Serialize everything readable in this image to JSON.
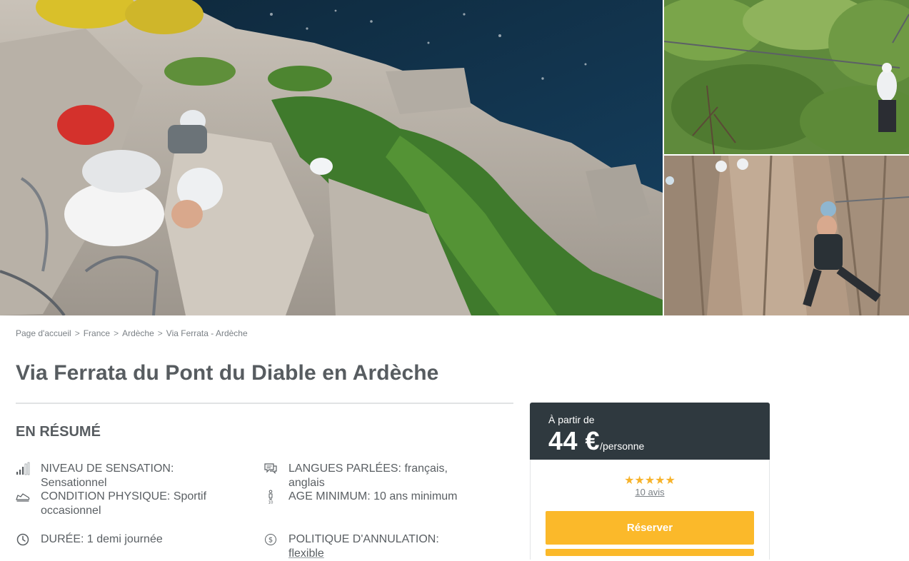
{
  "gallery": {
    "images": [
      {
        "name": "via-ferrata-climbers-above-river"
      },
      {
        "name": "zipline-over-forest"
      },
      {
        "name": "climber-on-rock-wall"
      }
    ]
  },
  "breadcrumb": {
    "items": [
      "Page d'accueil",
      "France",
      "Ardèche",
      "Via Ferrata - Ardèche"
    ],
    "separator": ">"
  },
  "page": {
    "title": "Via Ferrata du Pont du Diable en Ardèche"
  },
  "summary": {
    "heading": "EN RÉSUMÉ",
    "facts": [
      {
        "icon": "signal-bars-icon",
        "label": "NIVEAU DE SENSATION:",
        "value": "Sensationnel"
      },
      {
        "icon": "speech-bubbles-icon",
        "label": "LANGUES PARLÉES:",
        "value": "français, anglais"
      },
      {
        "icon": "sneaker-icon",
        "label": "CONDITION PHYSIQUE:",
        "value": "Sportif occasionnel"
      },
      {
        "icon": "person-age-icon",
        "label": "AGE MINIMUM:",
        "value": "10 ans minimum"
      },
      {
        "icon": "clock-icon",
        "label": "DURÉE:",
        "value": "1 demi journée"
      },
      {
        "icon": "dollar-circle-icon",
        "label": "POLITIQUE D'ANNULATION:",
        "value": "flexible"
      }
    ]
  },
  "booking": {
    "from_label": "À partir de",
    "price": "44 €",
    "unit": "/personne",
    "rating": 5,
    "stars": "★★★★★",
    "reviews_label": "10 avis",
    "cta_label": "Réserver"
  },
  "colors": {
    "accent": "#fbb92a",
    "dark_header": "#2f393f",
    "text": "#5a5f63",
    "star": "#f7b32b"
  }
}
